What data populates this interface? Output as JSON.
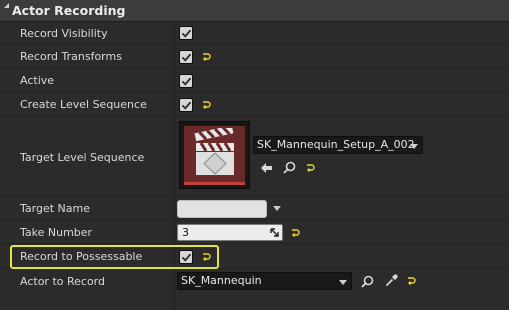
{
  "section": {
    "title": "Actor Recording"
  },
  "rows": {
    "record_visibility": {
      "label": "Record Visibility",
      "checked": true
    },
    "record_transforms": {
      "label": "Record Transforms",
      "checked": true
    },
    "active": {
      "label": "Active",
      "checked": true
    },
    "create_level_sequence": {
      "label": "Create Level Sequence",
      "checked": true
    },
    "target_level_sequence": {
      "label": "Target Level Sequence",
      "asset": "SK_Mannequin_Setup_A_002"
    },
    "target_name": {
      "label": "Target Name",
      "value": ""
    },
    "take_number": {
      "label": "Take Number",
      "value": "3"
    },
    "record_to_possessable": {
      "label": "Record to Possessable",
      "checked": true
    },
    "actor_to_record": {
      "label": "Actor to Record",
      "value": "SK_Mannequin"
    }
  },
  "icons": {
    "reset": "reset-to-default-icon",
    "use_selected": "use-selected-arrow-icon",
    "browse": "browse-magnifier-icon",
    "picker": "eyedropper-picker-icon",
    "clapper": "level-sequence-clapperboard-icon"
  },
  "colors": {
    "panel_bg": "#2b2b2b",
    "header_bg": "#3c3c3c",
    "highlight": "#e6e23a",
    "reset_icon": "#e8d820",
    "thumb_bg": "#6a2a29",
    "thumb_bar": "#c04040"
  }
}
